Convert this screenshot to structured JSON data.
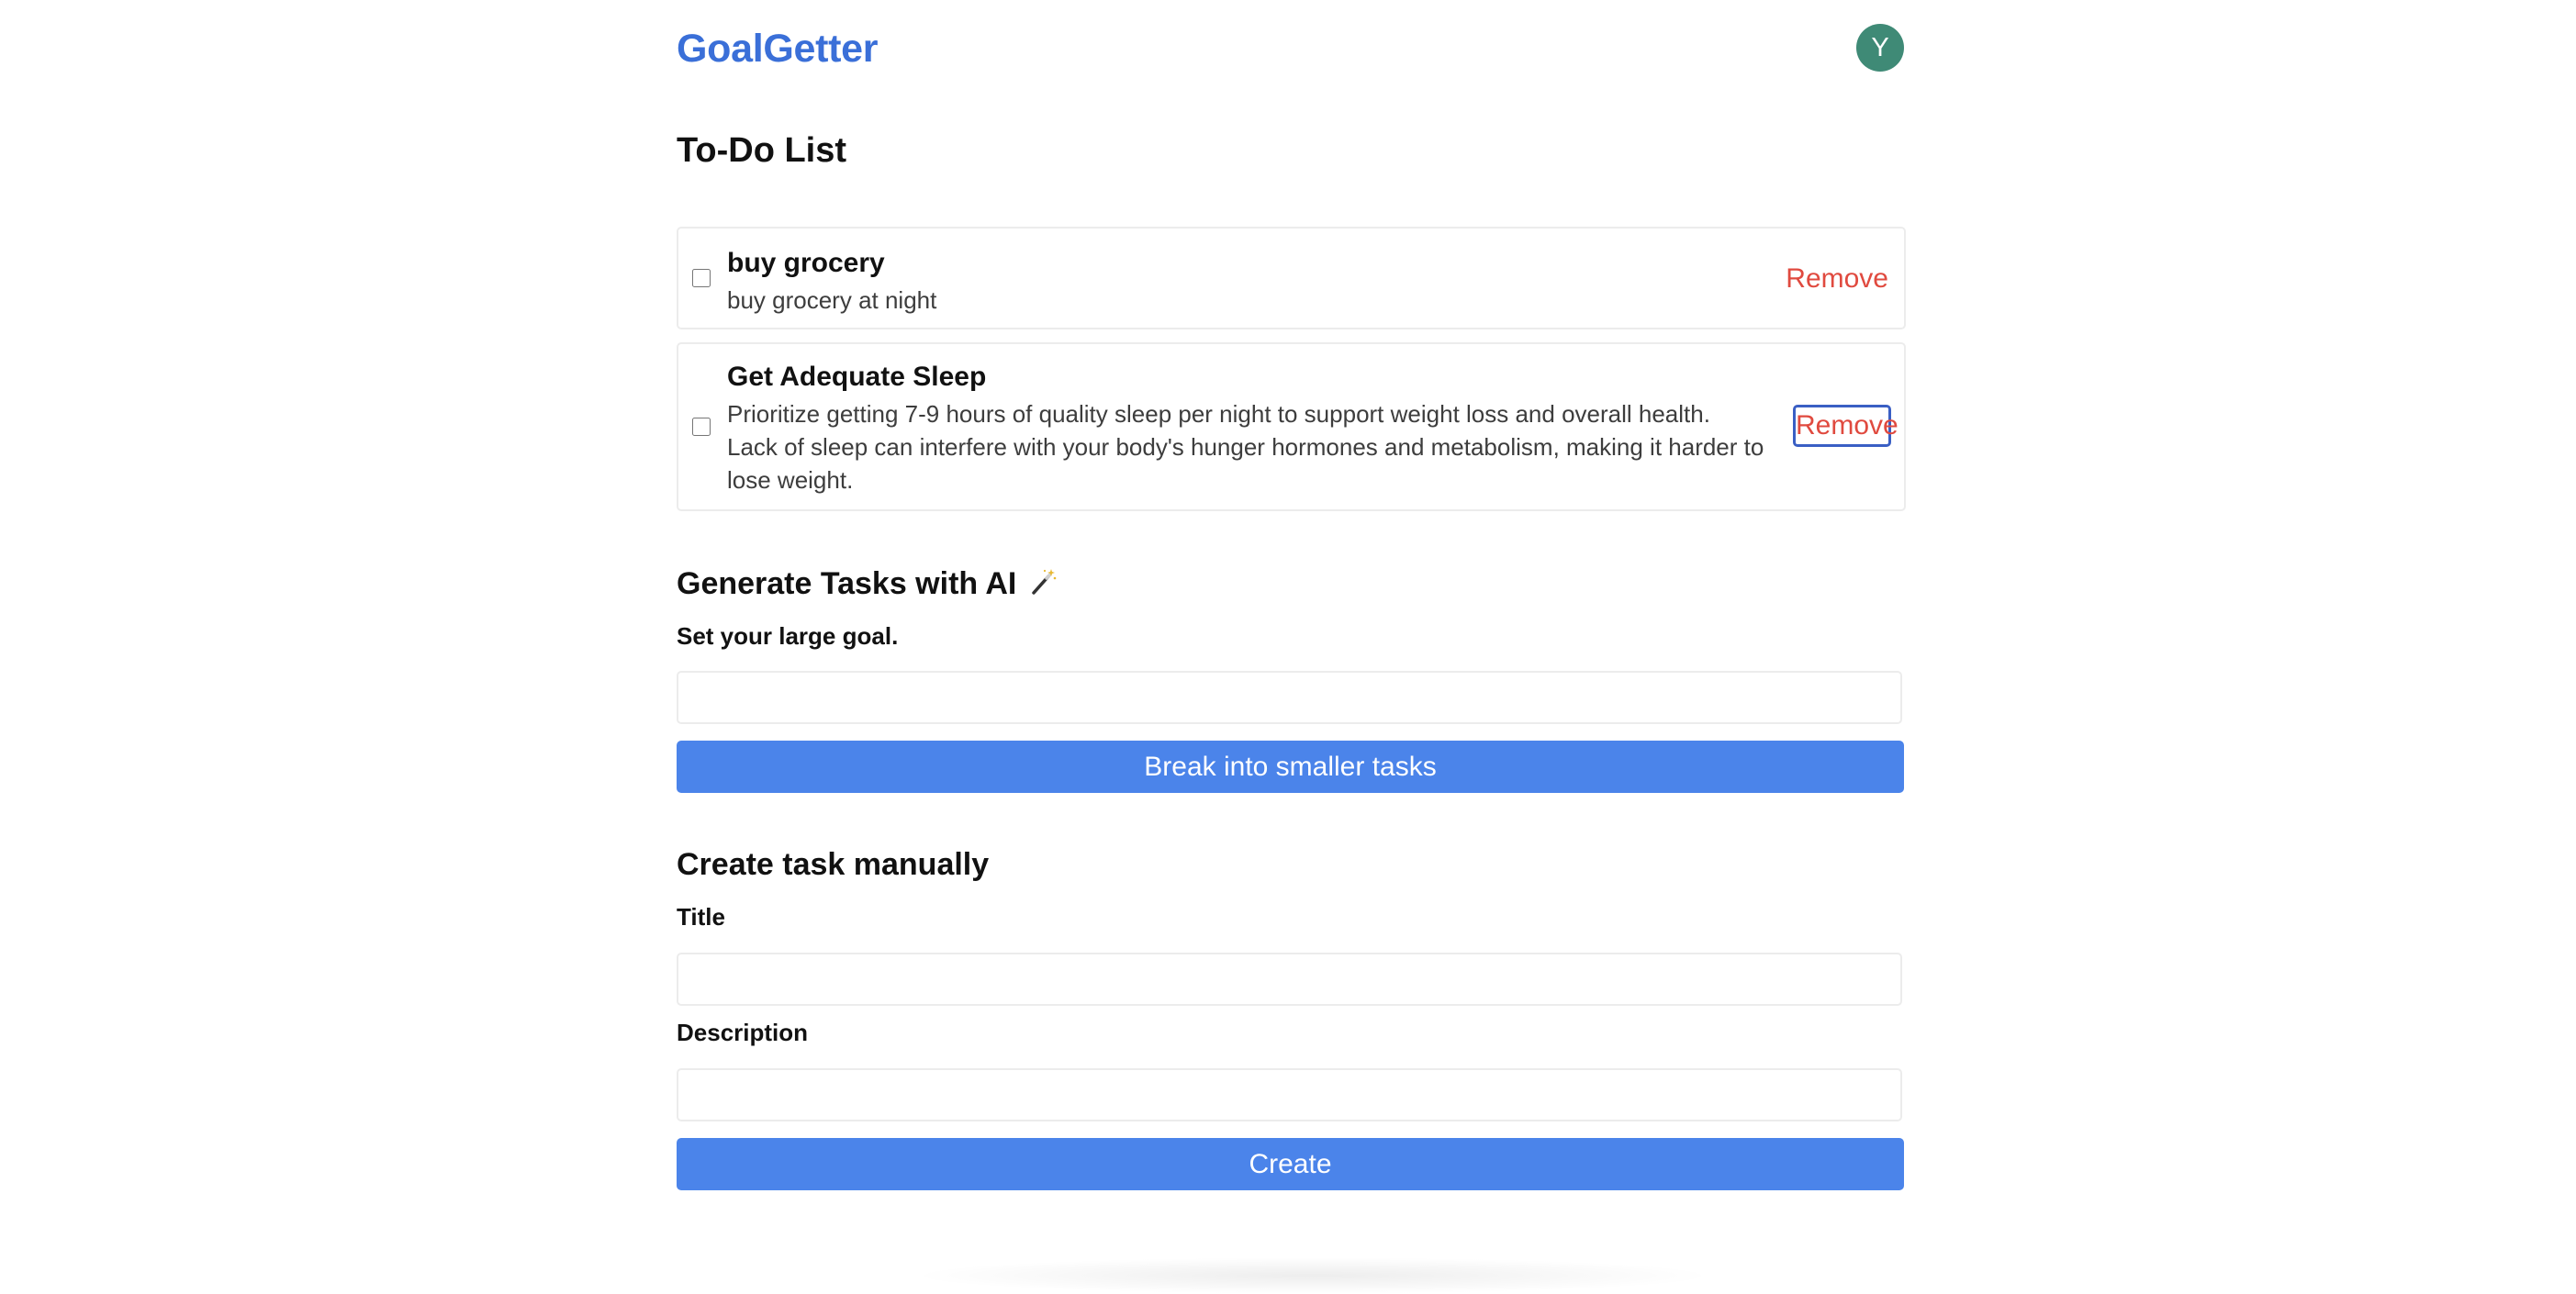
{
  "header": {
    "brand": "GoalGetter",
    "avatar_initial": "Y"
  },
  "todo": {
    "title": "To-Do List",
    "remove_label": "Remove",
    "items": [
      {
        "title": "buy grocery",
        "description": "buy grocery at night",
        "checked": false
      },
      {
        "title": "Get Adequate Sleep",
        "description": "Prioritize getting 7-9 hours of quality sleep per night to support weight loss and overall health. Lack of sleep can interfere with your body's hunger hormones and metabolism, making it harder to lose weight.",
        "checked": false
      }
    ]
  },
  "ai": {
    "title": "Generate Tasks with AI",
    "icon": "magic-wand-icon",
    "goal_label": "Set your large goal.",
    "goal_value": "",
    "button_label": "Break into smaller tasks"
  },
  "manual": {
    "title": "Create task manually",
    "title_label": "Title",
    "title_value": "",
    "description_label": "Description",
    "description_value": "",
    "button_label": "Create"
  },
  "colors": {
    "brand": "#3a6fd8",
    "avatar": "#3f8a76",
    "primary_button": "#4b84ea",
    "remove": "#e04a3f",
    "focus_ring": "#3a5fc4"
  }
}
